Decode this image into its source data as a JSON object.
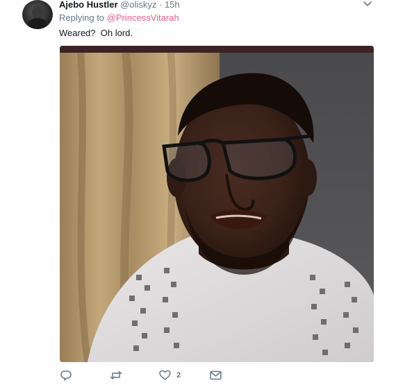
{
  "tweet": {
    "display_name": "Ajebo Hustler",
    "handle": "@oliskyz",
    "separator": "·",
    "time": "15h",
    "replying_prefix": "Replying to",
    "replying_to": "@PrincessVitarah",
    "text": "Weared?  Oh lord.",
    "menu_icon": "chevron-down-icon"
  },
  "actions": {
    "reply": {
      "icon": "reply-icon",
      "count": ""
    },
    "retweet": {
      "icon": "retweet-icon",
      "count": ""
    },
    "like": {
      "icon": "heart-icon",
      "count": "2"
    },
    "message": {
      "icon": "envelope-icon",
      "count": ""
    }
  },
  "colors": {
    "name": "#14171a",
    "secondary": "#657786",
    "mention": "#e85d8a"
  }
}
